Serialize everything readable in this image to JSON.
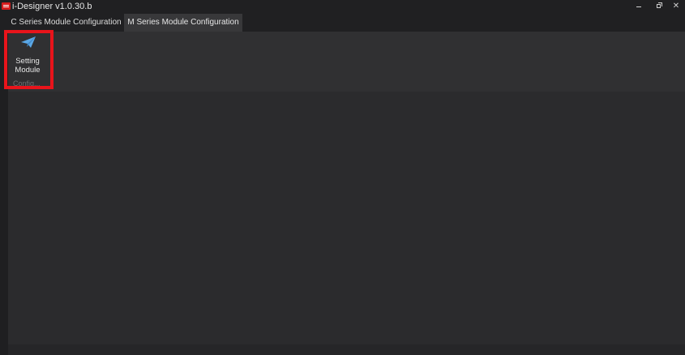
{
  "window": {
    "title": "i-Designer v1.0.30.b",
    "logo_icon": "app-logo-icon",
    "controls": {
      "minimize_icon": "minimize-icon",
      "maximize_icon": "restore-icon",
      "close_glyph": "✕"
    }
  },
  "tabs": [
    {
      "label": "C Series Module Configuration",
      "active": false
    },
    {
      "label": "M Series Module Configuration",
      "active": true
    }
  ],
  "ribbon": {
    "buttons": [
      {
        "label_line1": "Setting",
        "label_line2": "Module",
        "icon": "paper-plane-icon"
      }
    ],
    "group_label": "Config..."
  },
  "annotation": {
    "highlight_color": "#e8141b"
  },
  "colors": {
    "accent_icon": "#5aa7e6",
    "tab_active_bg": "#38383a",
    "ribbon_bg": "#303032",
    "content_bg": "#2b2b2d"
  }
}
